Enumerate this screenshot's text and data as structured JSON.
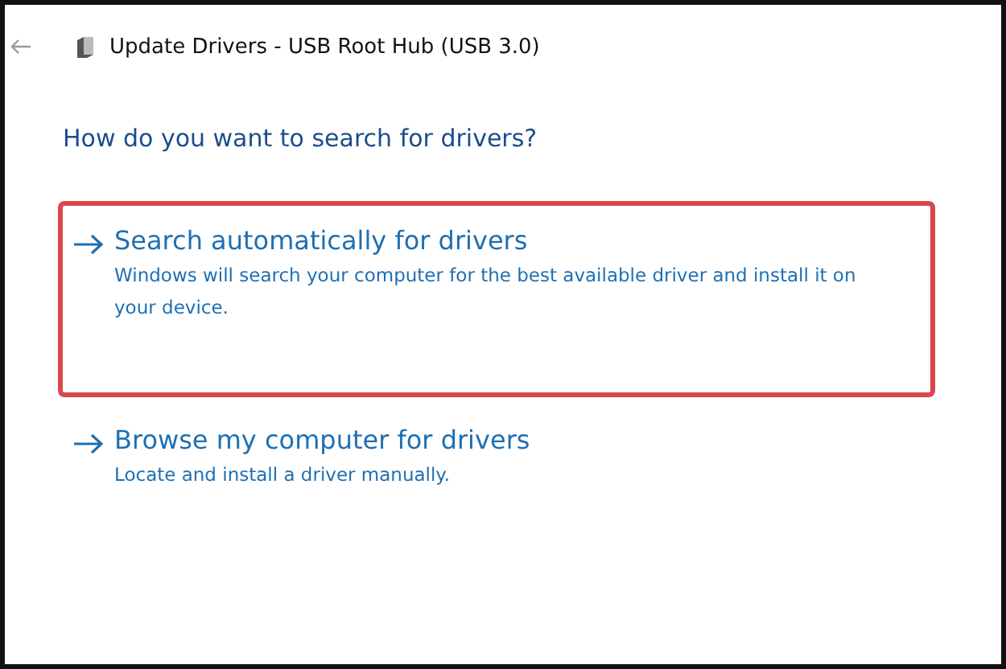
{
  "window": {
    "title": "Update Drivers - USB Root Hub (USB 3.0)"
  },
  "heading": "How do you want to search for drivers?",
  "options": [
    {
      "title": "Search automatically for drivers",
      "description": "Windows will search your computer for the best available driver and install it on your device.",
      "highlighted": true
    },
    {
      "title": "Browse my computer for drivers",
      "description": "Locate and install a driver manually.",
      "highlighted": false
    }
  ]
}
